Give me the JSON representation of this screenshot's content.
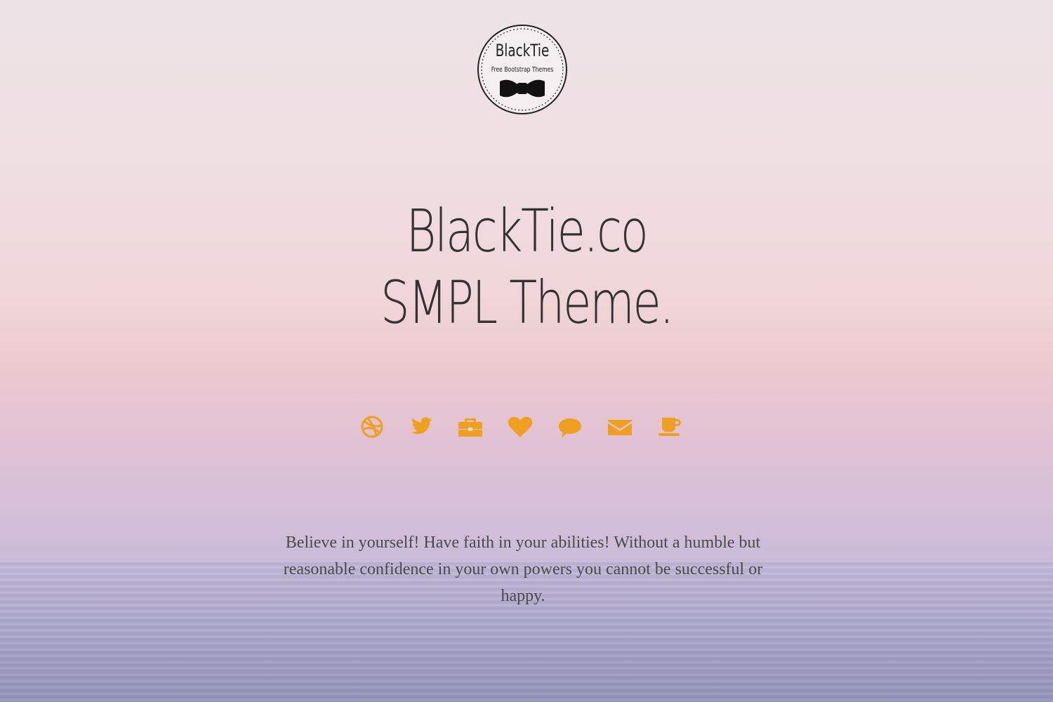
{
  "logo": {
    "name": "BlackTie",
    "tagline": "Free Bootstrap Themes"
  },
  "headline": {
    "line1": "BlackTie.co",
    "line2": "SMPL Theme."
  },
  "social": {
    "accent_color": "#f0a020",
    "icons": [
      {
        "name": "dribbble-icon"
      },
      {
        "name": "twitter-icon"
      },
      {
        "name": "briefcase-icon"
      },
      {
        "name": "heart-icon"
      },
      {
        "name": "comment-icon"
      },
      {
        "name": "envelope-icon"
      },
      {
        "name": "coffee-icon"
      }
    ]
  },
  "quote": {
    "text": "Believe in yourself! Have faith in your abilities! Without a humble but reasonable confidence in your own powers you cannot be successful or happy."
  }
}
